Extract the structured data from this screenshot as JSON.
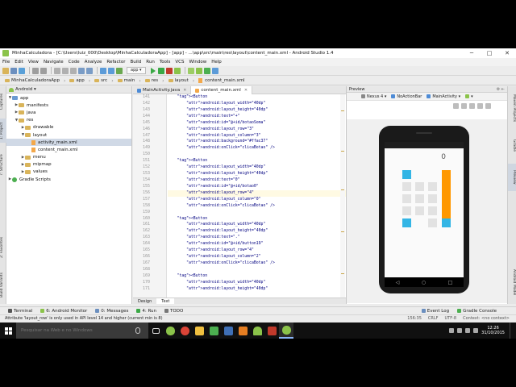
{
  "window": {
    "title": "MinhaCalculadora - [C:\\Users\\luiz_000\\Desktop\\MinhaCalculadoraApp] - [app] - ...\\app\\src\\main\\res\\layout\\content_main.xml - Android Studio 1.4"
  },
  "menu": [
    "File",
    "Edit",
    "View",
    "Navigate",
    "Code",
    "Analyze",
    "Refactor",
    "Build",
    "Run",
    "Tools",
    "VCS",
    "Window",
    "Help"
  ],
  "toolbar": {
    "config": "app"
  },
  "breadcrumb": [
    "MinhaCalculadoraApp",
    "app",
    "src",
    "main",
    "res",
    "layout",
    "content_main.xml"
  ],
  "project": {
    "selector": "Android",
    "tree": [
      {
        "label": "app",
        "depth": 0,
        "expanded": true,
        "icon": "folder-blue"
      },
      {
        "label": "manifests",
        "depth": 1,
        "expanded": false,
        "icon": "folder"
      },
      {
        "label": "java",
        "depth": 1,
        "expanded": false,
        "icon": "folder"
      },
      {
        "label": "res",
        "depth": 1,
        "expanded": true,
        "icon": "folder"
      },
      {
        "label": "drawable",
        "depth": 2,
        "expanded": false,
        "icon": "folder"
      },
      {
        "label": "layout",
        "depth": 2,
        "expanded": true,
        "icon": "folder"
      },
      {
        "label": "activity_main.xml",
        "depth": 3,
        "icon": "xml",
        "selected": true
      },
      {
        "label": "content_main.xml",
        "depth": 3,
        "icon": "xml"
      },
      {
        "label": "menu",
        "depth": 2,
        "expanded": false,
        "icon": "folder"
      },
      {
        "label": "mipmap",
        "depth": 2,
        "expanded": false,
        "icon": "folder"
      },
      {
        "label": "values",
        "depth": 2,
        "expanded": false,
        "icon": "folder"
      },
      {
        "label": "Gradle Scripts",
        "depth": 0,
        "expanded": false,
        "icon": "gradle"
      }
    ]
  },
  "left_strip": [
    "1: Project",
    "7: Structure",
    "Captures",
    "2: Favorites",
    "Build Variants"
  ],
  "right_strip": [
    "Maven Projects",
    "Gradle",
    "Preview",
    "Android Model"
  ],
  "editor": {
    "tabs": [
      {
        "label": "MainActivity.java",
        "active": false
      },
      {
        "label": "content_main.xml",
        "active": true
      }
    ],
    "line_numbers": [
      "141",
      "142",
      "143",
      "144",
      "145",
      "146",
      "147",
      "148",
      "149",
      "150",
      "151",
      "152",
      "153",
      "154",
      "155",
      "156",
      "157",
      "158",
      "159",
      "160",
      "161",
      "162",
      "163",
      "164",
      "165",
      "166",
      "167",
      "168",
      "169",
      "170",
      "171"
    ],
    "lines": [
      "    <Button",
      "        android:layout_width=\"40dp\"",
      "        android:layout_height=\"40dp\"",
      "        android:text=\"+\"",
      "        android:id=\"@+id/botaoSoma\"",
      "        android:layout_row=\"3\"",
      "        android:layout_column=\"3\"",
      "        android:background=\"#ffac37\"",
      "        android:onClick=\"clicaBotao\" />",
      "",
      "    <Button",
      "        android:layout_width=\"40dp\"",
      "        android:layout_height=\"40dp\"",
      "        android:text=\"0\"",
      "        android:id=\"@+id/botao0\"",
      "        android:layout_row=\"4\"",
      "        android:layout_column=\"0\"",
      "        android:onClick=\"clicaBotao\" />",
      "",
      "    <Button",
      "        android:layout_width=\"40dp\"",
      "        android:layout_height=\"40dp\"",
      "        android:text=\".\"",
      "        android:id=\"@+id/button19\"",
      "        android:layout_row=\"4\"",
      "        android:layout_column=\"2\"",
      "        android:onClick=\"clicaBotao\" />",
      "",
      "    <Button",
      "        android:layout_width=\"40dp\"",
      "        android:layout_height=\"40dp\""
    ],
    "design_tabs": [
      "Design",
      "Text"
    ]
  },
  "preview": {
    "title": "Preview",
    "device": "Nexus 4",
    "theme": "NoActionBar",
    "activity": "MainActivity",
    "display": "0"
  },
  "tool_windows": [
    "Terminal",
    "6: Android Monitor",
    "0: Messages",
    "4: Run",
    "TODO"
  ],
  "tool_windows_right": [
    "Event Log",
    "Gradle Console"
  ],
  "status": {
    "message": "Attribute 'layout_row' is only used in API level 14 and higher (current min is 8)",
    "position": "156:35",
    "encoding": "CRLF",
    "charset": "UTF-8",
    "context": "Context: <no context>"
  },
  "taskbar": {
    "search_placeholder": "Pesquisar na Web e no Windows",
    "time": "12:26",
    "date": "31/10/2015"
  },
  "colors": {
    "calc_orange": "#ff9800",
    "calc_blue": "#33b5e5",
    "string_green": "#008000",
    "attr_purple": "#660e7a"
  }
}
